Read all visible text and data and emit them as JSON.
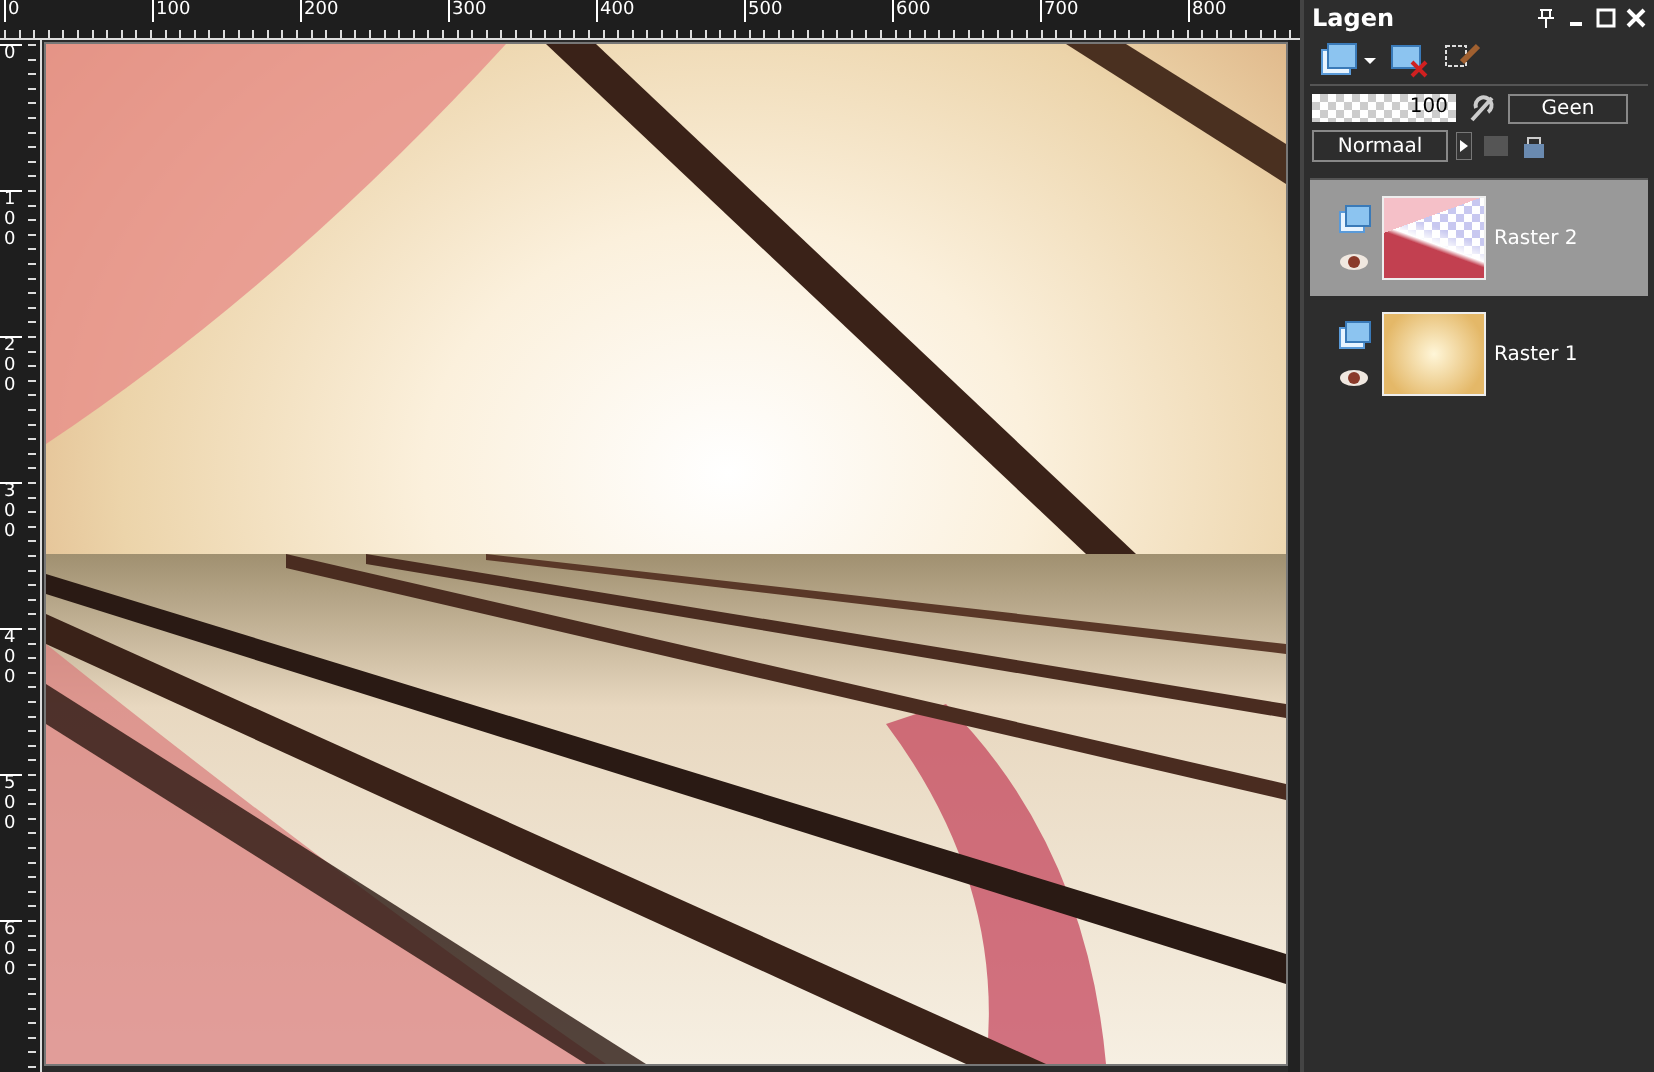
{
  "rulers": {
    "horizontal": [
      "0",
      "100",
      "200",
      "300",
      "400",
      "500",
      "600",
      "700",
      "800"
    ],
    "vertical": [
      "0",
      "100",
      "200",
      "300",
      "400",
      "500",
      "600"
    ]
  },
  "layers_panel": {
    "title": "Lagen",
    "opacity": "100",
    "mask_button": "Geen",
    "blend_mode": "Normaal",
    "layers": [
      {
        "name": "Raster 2",
        "selected": true,
        "kind": "transparent"
      },
      {
        "name": "Raster 1",
        "selected": false,
        "kind": "gold"
      }
    ]
  }
}
